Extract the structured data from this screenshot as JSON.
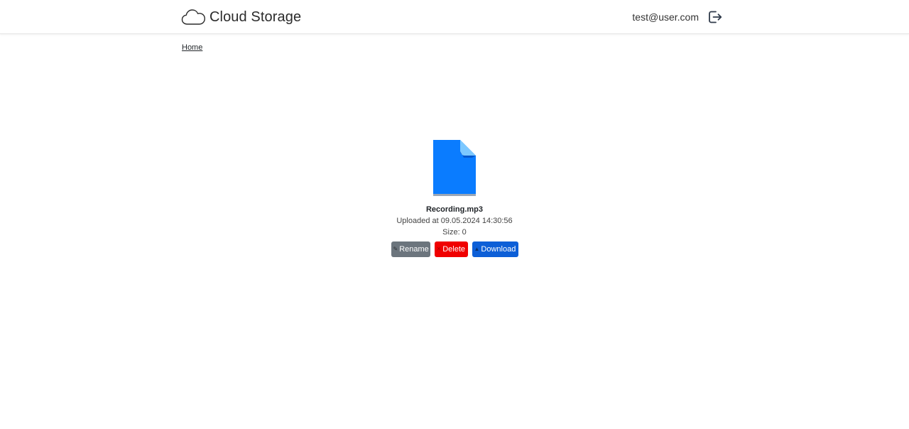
{
  "header": {
    "brand": "Cloud Storage",
    "brand_icon": "cloud-icon",
    "user_email": "test@user.com",
    "logout_icon": "logout-icon"
  },
  "breadcrumb": {
    "home": "Home"
  },
  "file": {
    "icon": "file-icon",
    "name": "Recording.mp3",
    "uploaded": "Uploaded at 09.05.2024 14:30:56",
    "size": "Size: 0"
  },
  "actions": {
    "rename_label": "Rename",
    "rename_icon": "pencil-icon",
    "delete_label": "Delete",
    "delete_icon": "x-icon",
    "download_label": "Download",
    "download_icon": "download-icon"
  },
  "colors": {
    "file_icon": "#0a7cff",
    "rename": "#6c757d",
    "delete": "#f00000",
    "download": "#0d5fd7"
  }
}
